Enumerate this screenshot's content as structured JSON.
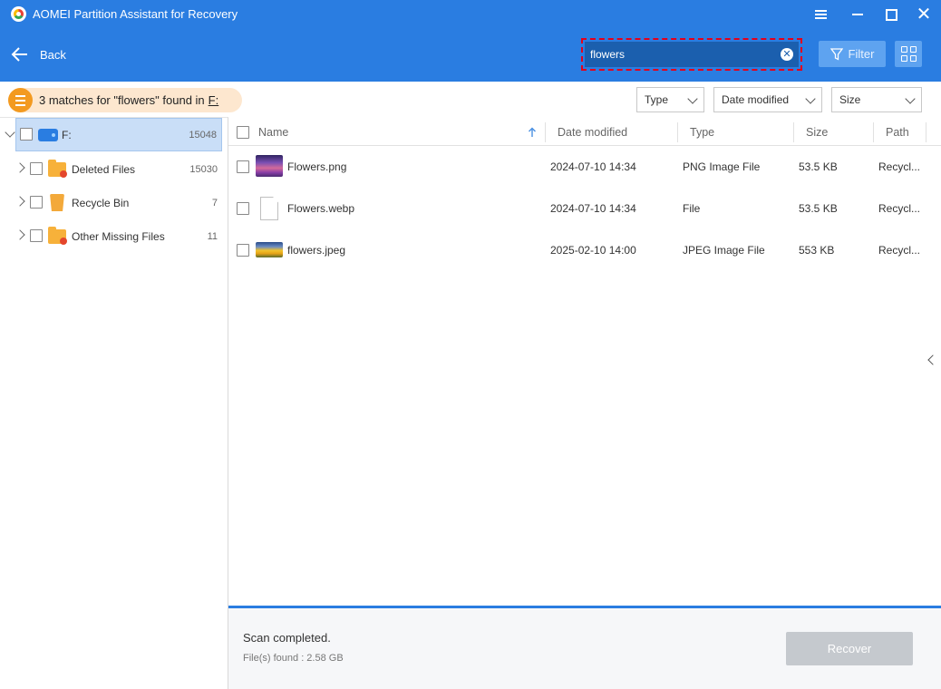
{
  "window": {
    "title": "AOMEI Partition Assistant for Recovery"
  },
  "header": {
    "back_label": "Back",
    "search_value": "flowers",
    "filter_label": "Filter"
  },
  "results": {
    "summary_prefix": "3 matches for \"flowers\" found in",
    "drive": "F:"
  },
  "filters": {
    "type_label": "Type",
    "date_label": "Date modified",
    "size_label": "Size"
  },
  "tree": {
    "root": {
      "label": "F:",
      "count": "15048"
    },
    "items": [
      {
        "label": "Deleted Files",
        "count": "15030",
        "icon": "folder-deleted-icon"
      },
      {
        "label": "Recycle Bin",
        "count": "7",
        "icon": "recycle-bin-icon"
      },
      {
        "label": "Other Missing Files",
        "count": "11",
        "icon": "folder-missing-icon"
      }
    ]
  },
  "table": {
    "columns": {
      "name": "Name",
      "date": "Date modified",
      "type": "Type",
      "size": "Size",
      "path": "Path"
    },
    "rows": [
      {
        "name": "Flowers.png",
        "date": "2024-07-10 14:34",
        "type": "PNG Image File",
        "size": "53.5 KB",
        "path": "Recycl..."
      },
      {
        "name": "Flowers.webp",
        "date": "2024-07-10 14:34",
        "type": "File",
        "size": "53.5 KB",
        "path": "Recycl..."
      },
      {
        "name": "flowers.jpeg",
        "date": "2025-02-10 14:00",
        "type": "JPEG Image File",
        "size": "553 KB",
        "path": "Recycl..."
      }
    ]
  },
  "status": {
    "title": "Scan completed.",
    "found": "File(s) found : 2.58 GB",
    "recover_label": "Recover"
  },
  "colors": {
    "header_bg": "#2a7de1",
    "accent_orange": "#f39a20",
    "selection_bg": "#c9def7",
    "search_highlight": "#e4001b"
  }
}
